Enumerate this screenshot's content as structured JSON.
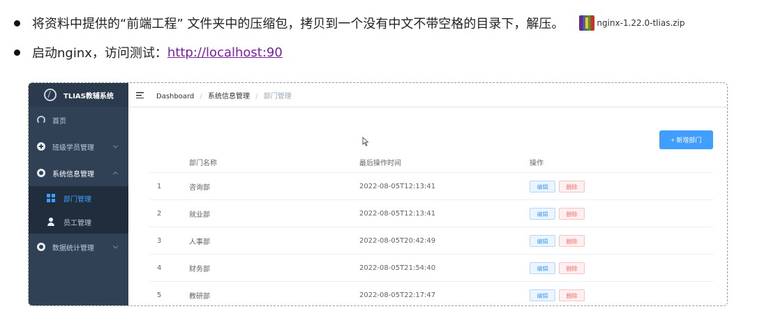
{
  "instructions": {
    "line1_text": "将资料中提供的“前端工程” 文件夹中的压缩包，拷贝到一个没有中文不带空格的目录下，解压。",
    "zip_file": "nginx-1.22.0-tlias.zip",
    "line2_prefix": "启动nginx，访问测试：",
    "line2_link": "http://localhost:90"
  },
  "app": {
    "brand": "TLIAS教辅系统",
    "sidebar": {
      "items": [
        {
          "label": "首页",
          "icon": "dashboard-icon"
        },
        {
          "label": "班级学员管理",
          "icon": "plus-circle-icon"
        },
        {
          "label": "系统信息管理",
          "icon": "gear-icon",
          "children": [
            {
              "label": "部门管理",
              "icon": "grid-icon"
            },
            {
              "label": "员工管理",
              "icon": "user-icon"
            }
          ]
        },
        {
          "label": "数据统计管理",
          "icon": "gear-icon"
        }
      ]
    },
    "breadcrumb": {
      "items": [
        "Dashboard",
        "系统信息管理",
        "部门管理"
      ],
      "separator": "/"
    },
    "add_button": "+ 新增部门",
    "table": {
      "headers": [
        "",
        "部门名称",
        "最后操作时间",
        "操作"
      ],
      "rows": [
        {
          "index": "1",
          "name": "咨询部",
          "time": "2022-08-05T12:13:41"
        },
        {
          "index": "2",
          "name": "就业部",
          "time": "2022-08-05T12:13:41"
        },
        {
          "index": "3",
          "name": "人事部",
          "time": "2022-08-05T20:42:49"
        },
        {
          "index": "4",
          "name": "财务部",
          "time": "2022-08-05T21:54:40"
        },
        {
          "index": "5",
          "name": "教研部",
          "time": "2022-08-05T22:17:47"
        }
      ],
      "edit_label": "编辑",
      "delete_label": "删除"
    },
    "colors": {
      "sidebar_bg": "#304156",
      "accent": "#409eff",
      "danger": "#f56c6c",
      "link": "#7b1fa2"
    }
  }
}
